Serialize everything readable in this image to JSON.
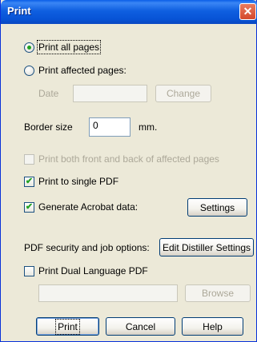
{
  "window": {
    "title": "Print",
    "close_label": "✕"
  },
  "print_all_pages": {
    "label": "Print all pages",
    "checked": true
  },
  "print_affected_pages": {
    "label": "Print affected pages:",
    "checked": false
  },
  "date_field": {
    "label": "Date",
    "value": ""
  },
  "change_button": {
    "label": "Change"
  },
  "border_size": {
    "label": "Border size",
    "value": "0",
    "unit": "mm."
  },
  "both_sides": {
    "label": "Print both front and back of affected pages",
    "checked": false
  },
  "single_pdf": {
    "label": "Print to single PDF",
    "checked": true
  },
  "acrobat_data": {
    "label": "Generate Acrobat data:",
    "checked": true
  },
  "settings_button": {
    "label": "Settings"
  },
  "pdf_security": {
    "label": "PDF security and job options:"
  },
  "distiller_button": {
    "label": "Edit Distiller Settings"
  },
  "dual_language": {
    "label": "Print Dual Language PDF",
    "checked": false
  },
  "dual_path": {
    "value": ""
  },
  "browse_button": {
    "label": "Browse"
  },
  "print_button": {
    "label": "Print"
  },
  "cancel_button": {
    "label": "Cancel"
  },
  "help_button": {
    "label": "Help"
  },
  "check_mark": "✔"
}
